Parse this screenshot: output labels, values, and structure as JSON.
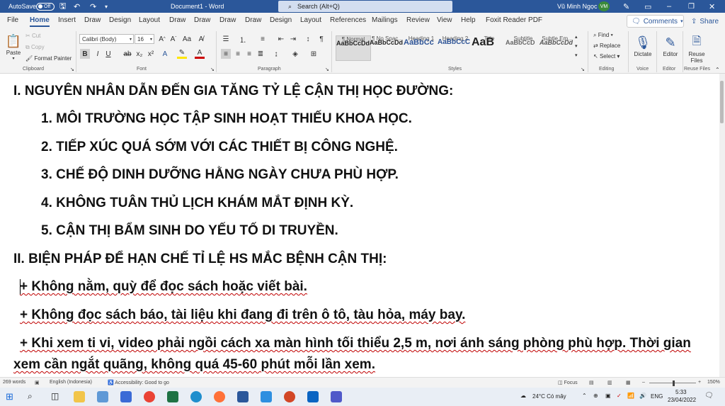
{
  "titlebar": {
    "autosave_label": "AutoSave",
    "autosave_state": "Off",
    "doc_title": "Document1 - Word",
    "search_placeholder": "Search (Alt+Q)",
    "user_name": "Vũ Minh Ngọc",
    "user_initials": "VM"
  },
  "menubar": {
    "tabs": [
      "File",
      "Home",
      "Insert",
      "Draw",
      "Design",
      "Layout",
      "Draw",
      "Draw",
      "Draw",
      "Draw",
      "Design",
      "Layout",
      "References",
      "Mailings",
      "Review",
      "View",
      "Help",
      "Foxit Reader PDF"
    ],
    "comments_label": "Comments",
    "share_label": "Share"
  },
  "ribbon": {
    "clipboard": {
      "paste": "Paste",
      "cut": "Cut",
      "copy": "Copy",
      "format_painter": "Format Painter",
      "label": "Clipboard"
    },
    "font": {
      "family": "Calibri (Body)",
      "size": "16",
      "label": "Font"
    },
    "paragraph": {
      "label": "Paragraph"
    },
    "styles": {
      "items": [
        {
          "preview": "AaBbCcDd",
          "name": "¶ Normal"
        },
        {
          "preview": "AaBbCcDd",
          "name": "¶ No Spac..."
        },
        {
          "preview": "AaBbCc",
          "name": "Heading 1"
        },
        {
          "preview": "AaBbCcC",
          "name": "Heading 2"
        },
        {
          "preview": "AaB",
          "name": "Title"
        },
        {
          "preview": "AaBbCcD",
          "name": "Subtitle"
        },
        {
          "preview": "AaBbCcDd",
          "name": "Subtle Em..."
        }
      ],
      "label": "Styles"
    },
    "editing": {
      "find": "Find",
      "replace": "Replace",
      "select": "Select",
      "label": "Editing"
    },
    "voice": {
      "dictate": "Dictate",
      "label": "Voice"
    },
    "editor": {
      "editor": "Editor",
      "label": "Editor"
    },
    "reuse": {
      "reuse": "Reuse Files",
      "label": "Reuse Files"
    }
  },
  "document": {
    "heading1": "I. NGUYÊN NHÂN DẪN ĐẾN GIA TĂNG TỶ LỆ CẬN THỊ HỌC ĐƯỜNG:",
    "causes": [
      "1. MÔI TRƯỜNG HỌC TẬP SINH HOẠT THIẾU KHOA HỌC.",
      "2. TIẾP XÚC QUÁ SỚM VỚI CÁC THIẾT BỊ CÔNG NGHỆ.",
      "3. CHẾ ĐỘ DINH DƯỠNG HẰNG NGÀY CHƯA PHÙ HỢP.",
      "4. KHÔNG TUÂN THỦ LỊCH KHÁM MẮT ĐỊNH KỲ.",
      "5. CẬN THỊ BẨM SINH DO YẾU TỐ DI TRUYỀN."
    ],
    "heading2": "II. BIỆN PHÁP ĐỂ HẠN CHẾ TỈ LỆ HS MẮC BỆNH CẬN THỊ:",
    "measures": [
      "+ Không nằm, quỳ để đọc sách hoặc viết bài.",
      "+ Không đọc sách báo, tài liệu khi đang đi trên ô tô, tàu hỏa, máy bay.",
      "+ Khi xem ti vi, video phải ngồi cách xa màn hình tối thiểu 2,5 m, nơi ánh sáng phòng phù hợp. Thời gian",
      "xem cần ngắt quãng, không quá 45-60 phút mỗi lần xem."
    ]
  },
  "status": {
    "words": "269 words",
    "language": "English (Indonesia)",
    "accessibility": "Accessibility: Good to go",
    "focus": "Focus",
    "zoom": "150%"
  },
  "taskbar": {
    "weather": "24°C  Có mây",
    "lang": "ENG",
    "time": "5:33",
    "date": "23/04/2022"
  },
  "colors": {
    "accent": "#2b579a",
    "squiggle": "#c00000"
  }
}
